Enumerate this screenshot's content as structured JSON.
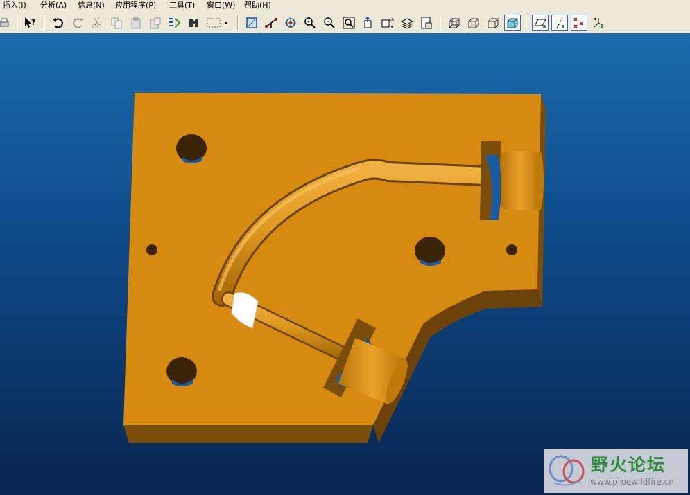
{
  "menu": {
    "items": [
      {
        "label": "插入(I)"
      },
      {
        "label": "分析(A)"
      },
      {
        "label": "信息(N)"
      },
      {
        "label": "应用程序(P)"
      },
      {
        "label": "工具(T)"
      },
      {
        "label": "窗口(W)"
      },
      {
        "label": "帮助(H)"
      }
    ]
  },
  "toolbar": {
    "icons": [
      "print-icon",
      "whats-this-icon",
      "undo-icon",
      "redo-icon",
      "cut-icon",
      "copy-icon",
      "paste-icon",
      "paste-special-icon",
      "regenerate-icon",
      "find-icon",
      "select-box-icon",
      "datum-display-icon",
      "axis-display-icon",
      "spin-center-icon",
      "zoom-in-icon",
      "zoom-out-icon",
      "refit-icon",
      "reorient-icon",
      "saved-views-icon",
      "layers-icon",
      "model-tree-icon",
      "wireframe-icon",
      "hidden-line-icon",
      "no-hidden-icon",
      "shading-icon",
      "datum-planes-icon",
      "datum-axes-icon",
      "datum-points-icon",
      "coordinate-systems-icon"
    ]
  },
  "colors": {
    "model_top": "#d68a10",
    "model_side": "#7a4d0a",
    "viewport_top": "#1b6bad",
    "viewport_bottom": "#08254f",
    "highlight": "#ffffff"
  },
  "watermark": {
    "title": "野火论坛",
    "url": "www.proewildfire.cn"
  }
}
